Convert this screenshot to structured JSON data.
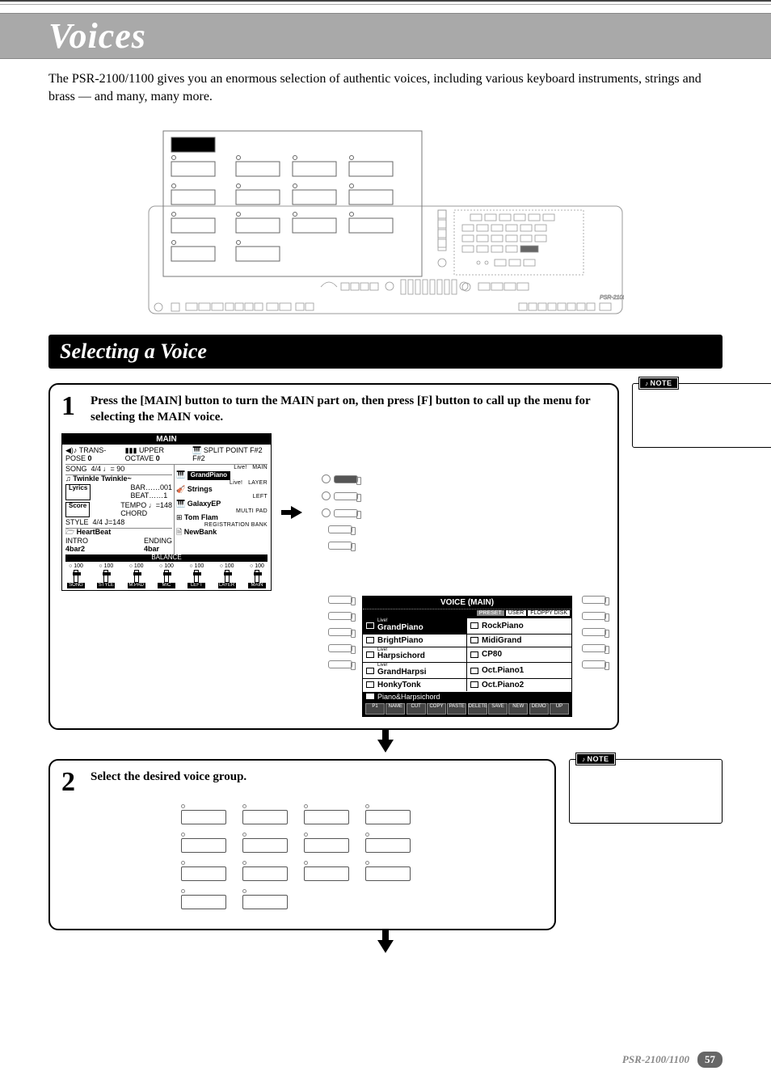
{
  "page": {
    "title": "Voices",
    "intro": "The PSR-2100/1100 gives you an enormous selection of authentic voices, including various keyboard instruments, strings and brass — and many, many more.",
    "section_title": "Selecting a Voice",
    "footer_model": "PSR-2100/1100",
    "footer_page": "57"
  },
  "steps": [
    {
      "number": "1",
      "text": "Press the [MAIN] button to turn the MAIN part on, then press [F] button to call up the menu for selecting the MAIN voice.",
      "note_label": "NOTE"
    },
    {
      "number": "2",
      "text": "Select the desired voice group.",
      "note_label": "NOTE"
    }
  ],
  "lcd_main": {
    "title": "MAIN",
    "top_labels": [
      "TRANS-POSE",
      "0",
      "UPPER OCTAVE",
      "0",
      "SPLIT POINT",
      "F#2",
      "F#2"
    ],
    "song_line": {
      "label": "SONG",
      "meta": "4/4   ♩= 90",
      "value": "Twinkle Twinkle~"
    },
    "main_voice": {
      "sub": "Live!",
      "name": "GrandPiano",
      "tag": "MAIN"
    },
    "lyrics_btn": "Lyrics",
    "score_btn": "Score",
    "bar_beat": {
      "bar_label": "BAR",
      "bar": "001",
      "beat_label": "BEAT",
      "beat": "1"
    },
    "tempo": {
      "label": "TEMPO",
      "value": "♩=148"
    },
    "chord_label": "CHORD",
    "layer_voice": {
      "sub": "Live!",
      "name": "Strings",
      "tag": "LAYER"
    },
    "left_voice": {
      "name": "GalaxyEP",
      "tag": "LEFT"
    },
    "style": {
      "label": "STYLE",
      "meta": "4/4   J=148",
      "name": "HeartBeat"
    },
    "multipad": {
      "tag": "MULTI PAD",
      "name": "Tom Flam"
    },
    "intro_ending": {
      "intro_label": "INTRO",
      "intro": "4bar2",
      "ending_label": "ENDING",
      "ending": "4bar"
    },
    "reg_bank": {
      "tag": "REGISTRATION BANK",
      "name": "NewBank"
    },
    "balance_title": "BALANCE",
    "balance": [
      {
        "val": "100",
        "label": "SONG"
      },
      {
        "val": "100",
        "label": "STYLE"
      },
      {
        "val": "100",
        "label": "M.PAD"
      },
      {
        "val": "100",
        "label": "MIC"
      },
      {
        "val": "100",
        "label": "LEFT"
      },
      {
        "val": "100",
        "label": "LAYER"
      },
      {
        "val": "100",
        "label": "MAIN"
      }
    ]
  },
  "voice_screen": {
    "title": "VOICE (MAIN)",
    "tabs": [
      "PRESET",
      "USER",
      "FLOPPY DISK"
    ],
    "active_tab": 0,
    "grid": [
      [
        {
          "sup": "Live!",
          "name": "GrandPiano",
          "selected": true
        },
        {
          "name": "RockPiano"
        }
      ],
      [
        {
          "name": "BrightPiano"
        },
        {
          "name": "MidiGrand"
        }
      ],
      [
        {
          "sup": "Live!",
          "name": "Harpsichord"
        },
        {
          "name": "CP80"
        }
      ],
      [
        {
          "sup": "Live!",
          "name": "GrandHarpsi"
        },
        {
          "name": "Oct.Piano1"
        }
      ],
      [
        {
          "name": "HonkyTonk"
        },
        {
          "name": "Oct.Piano2"
        }
      ]
    ],
    "category": "Piano&Harpsichord",
    "footer_btns": [
      "P1",
      "NAME",
      "CUT",
      "COPY",
      "PASTE",
      "DELETE",
      "SAVE",
      "NEW",
      "DEMO",
      "UP"
    ]
  },
  "colors": {
    "title_bar_bg": "#a9a9a9",
    "section_bg": "#000000"
  }
}
